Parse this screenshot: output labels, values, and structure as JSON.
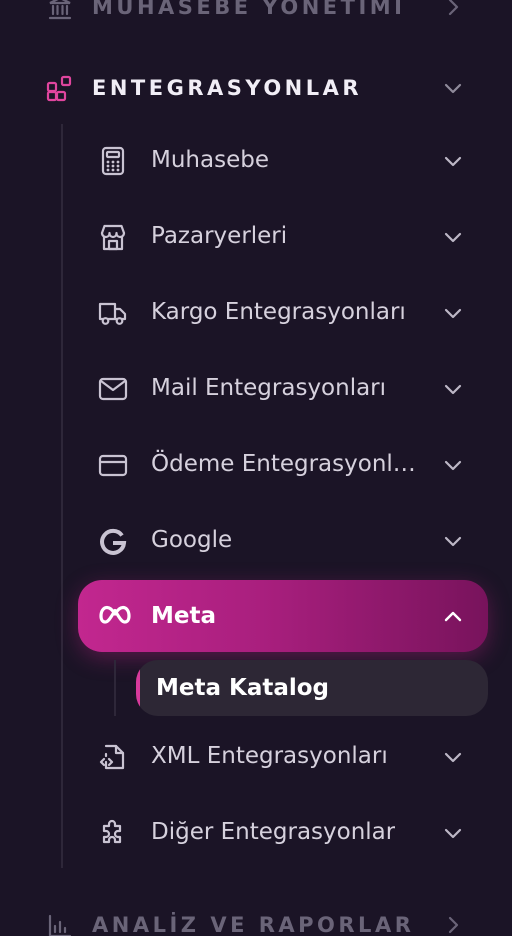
{
  "sections": {
    "accounting": {
      "label": "MUHASEBE YÖNETİMİ",
      "icon": "bank-icon"
    },
    "integrations": {
      "label": "ENTEGRASYONLAR",
      "icon": "blocks-icon",
      "accent": "#e0459e"
    },
    "reports": {
      "label": "ANALİZ VE RAPORLAR",
      "icon": "bar-chart-icon"
    }
  },
  "items": [
    {
      "label": "Muhasebe",
      "icon": "calculator-icon"
    },
    {
      "label": "Pazaryerleri",
      "icon": "storefront-icon"
    },
    {
      "label": "Kargo Entegrasyonları",
      "icon": "truck-icon"
    },
    {
      "label": "Mail Entegrasyonları",
      "icon": "mail-icon"
    },
    {
      "label": "Ödeme Entegrasyonları",
      "icon": "credit-card-icon"
    },
    {
      "label": "Google",
      "icon": "google-icon"
    },
    {
      "label": "Meta",
      "icon": "meta-icon",
      "active": true
    },
    {
      "label": "XML Entegrasyonları",
      "icon": "xml-file-icon"
    },
    {
      "label": "Diğer Entegrasyonlar",
      "icon": "puzzle-icon"
    }
  ],
  "meta_submenu": [
    {
      "label": "Meta Katalog",
      "active": true
    }
  ],
  "colors": {
    "background": "#1b1426",
    "active_gradient_start": "#c2278f",
    "active_gradient_end": "#78135c",
    "accent": "#e0459e",
    "text": "#d6d1dd",
    "dim_text": "#6a6478"
  }
}
